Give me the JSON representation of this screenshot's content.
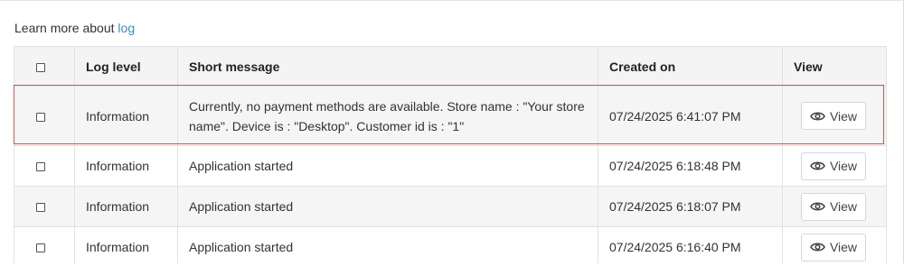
{
  "learn_more": {
    "prefix": "Learn more about",
    "link": "log"
  },
  "table": {
    "columns": {
      "log_level": "Log level",
      "short_message": "Short message",
      "created_on": "Created on",
      "view": "View"
    },
    "rows": [
      {
        "log_level": "Information",
        "short_message": "Currently, no payment methods are available. Store name : \"Your store name\". Device is : \"Desktop\". Customer id is : \"1\"",
        "created_on": "07/24/2025 6:41:07 PM",
        "view_label": "View",
        "highlighted": true
      },
      {
        "log_level": "Information",
        "short_message": "Application started",
        "created_on": "07/24/2025 6:18:48 PM",
        "view_label": "View"
      },
      {
        "log_level": "Information",
        "short_message": "Application started",
        "created_on": "07/24/2025 6:18:07 PM",
        "view_label": "View"
      },
      {
        "log_level": "Information",
        "short_message": "Application started",
        "created_on": "07/24/2025 6:16:40 PM",
        "view_label": "View"
      }
    ]
  },
  "icons": {
    "view": "eye-icon",
    "select": "checkbox"
  },
  "colors": {
    "link": "#3c8dbc",
    "highlight_border": "#d9534f",
    "header_bg": "#f4f4f4",
    "striped_row_bg": "#f5f5f5"
  }
}
